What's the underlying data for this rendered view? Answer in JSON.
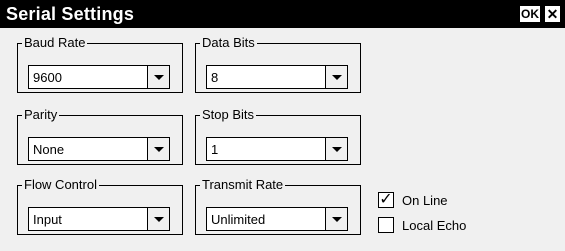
{
  "window": {
    "title": "Serial Settings",
    "ok_label": "OK",
    "close_glyph": "✕"
  },
  "groups": {
    "baud_rate": {
      "label": "Baud Rate",
      "value": "9600"
    },
    "data_bits": {
      "label": "Data Bits",
      "value": "8"
    },
    "parity": {
      "label": "Parity",
      "value": "None"
    },
    "stop_bits": {
      "label": "Stop Bits",
      "value": "1"
    },
    "flow_control": {
      "label": "Flow Control",
      "value": "Input"
    },
    "transmit_rate": {
      "label": "Transmit Rate",
      "value": "Unlimited"
    }
  },
  "checkboxes": {
    "on_line": {
      "label": "On Line",
      "checked": true,
      "mark": "✓"
    },
    "local_echo": {
      "label": "Local Echo",
      "checked": false,
      "mark": ""
    }
  }
}
